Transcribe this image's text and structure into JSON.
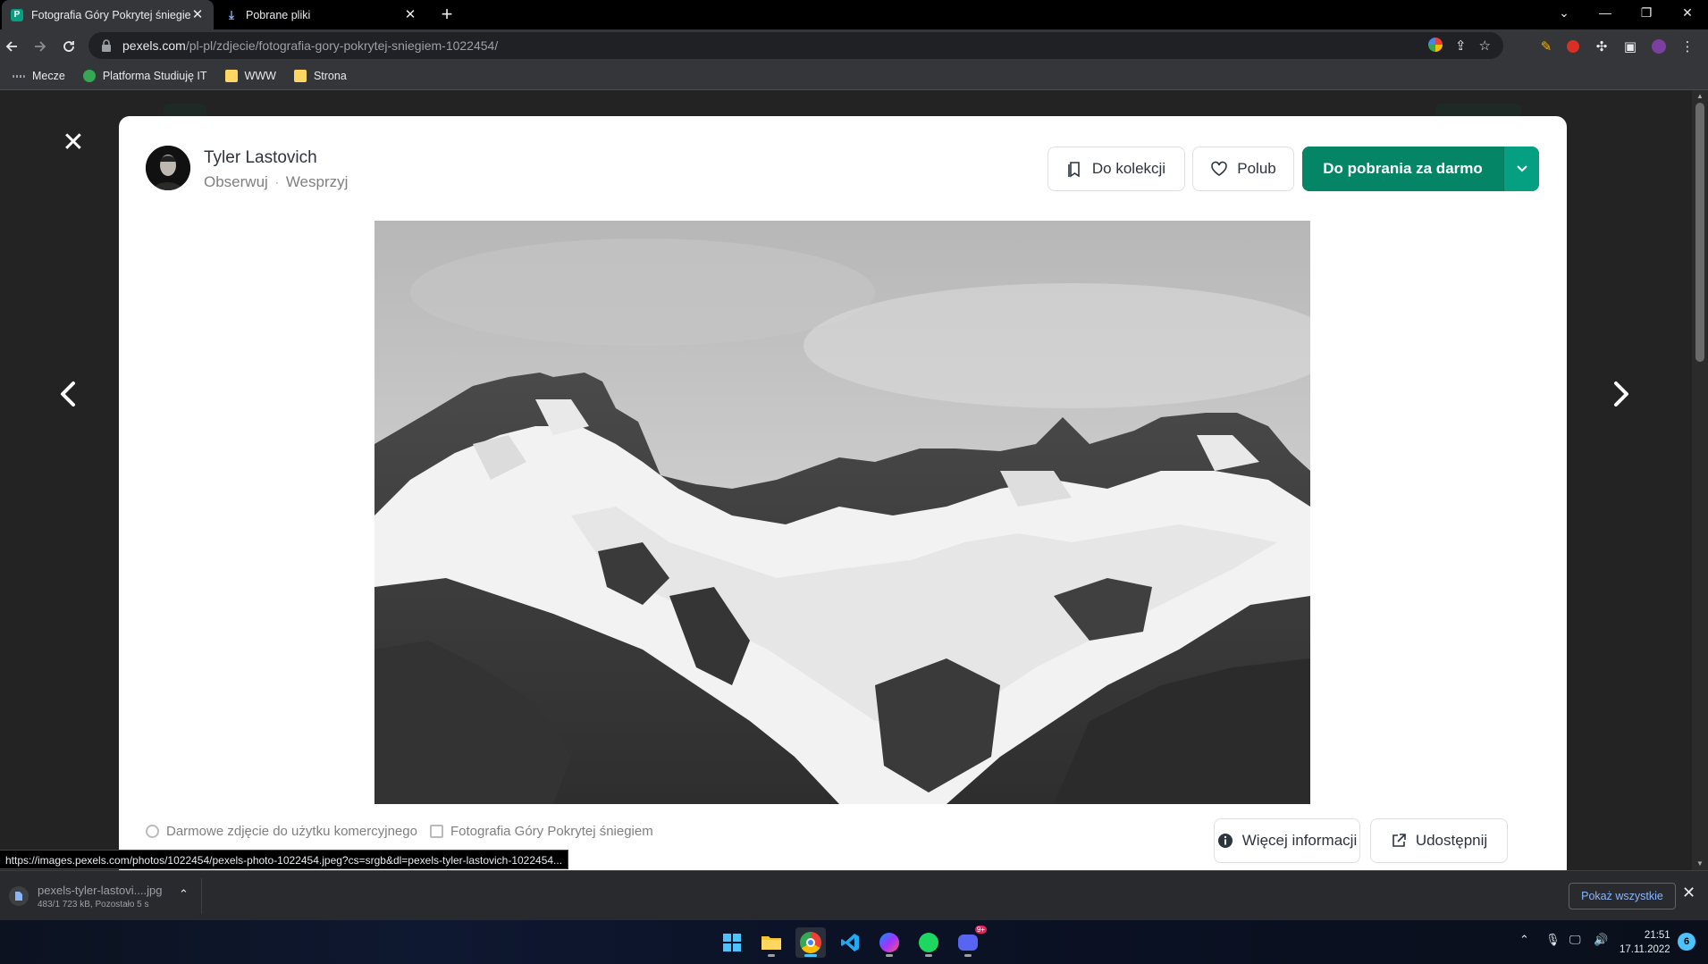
{
  "browser": {
    "tabs": [
      {
        "title": "Fotografia Góry Pokrytej śniegiem",
        "favicon": "pexels-favicon-icon",
        "active": true
      },
      {
        "title": "Pobrane pliki",
        "favicon": "download-icon",
        "active": false
      }
    ],
    "url_host": "pexels.com",
    "url_path": "/pl-pl/zdjecie/fotografia-gory-pokrytej-sniegiem-1022454/",
    "bookmarks": [
      {
        "label": "Mecze"
      },
      {
        "label": "Platforma Studiuję IT"
      },
      {
        "label": "WWW"
      },
      {
        "label": "Strona"
      }
    ],
    "status_url": "https://images.pexels.com/photos/1022454/pexels-photo-1022454.jpeg?cs=srgb&dl=pexels-tyler-lastovich-1022454..."
  },
  "modal": {
    "author": {
      "name": "Tyler Lastovich",
      "follow": "Obserwuj",
      "separator": "·",
      "support": "Wesprzyj"
    },
    "actions": {
      "collection": "Do kolekcji",
      "like": "Polub",
      "download": "Do pobrania za darmo"
    },
    "footer": {
      "meta_1": "Darmowe zdjęcie do użytku komercyjnego",
      "meta_2": "Fotografia Góry Pokrytej śniegiem",
      "more_info": "Więcej informacji",
      "share": "Udostępnij"
    },
    "accent_color": "#05a081"
  },
  "downloads": {
    "filename": "pexels-tyler-lastovi....jpg",
    "status": "483/1 723 kB, Pozostało 5 s",
    "show_all": "Pokaż wszystkie"
  },
  "taskbar": {
    "time": "21:51",
    "date": "17.11.2022",
    "notifications": "6",
    "discord_badge": "9+"
  }
}
